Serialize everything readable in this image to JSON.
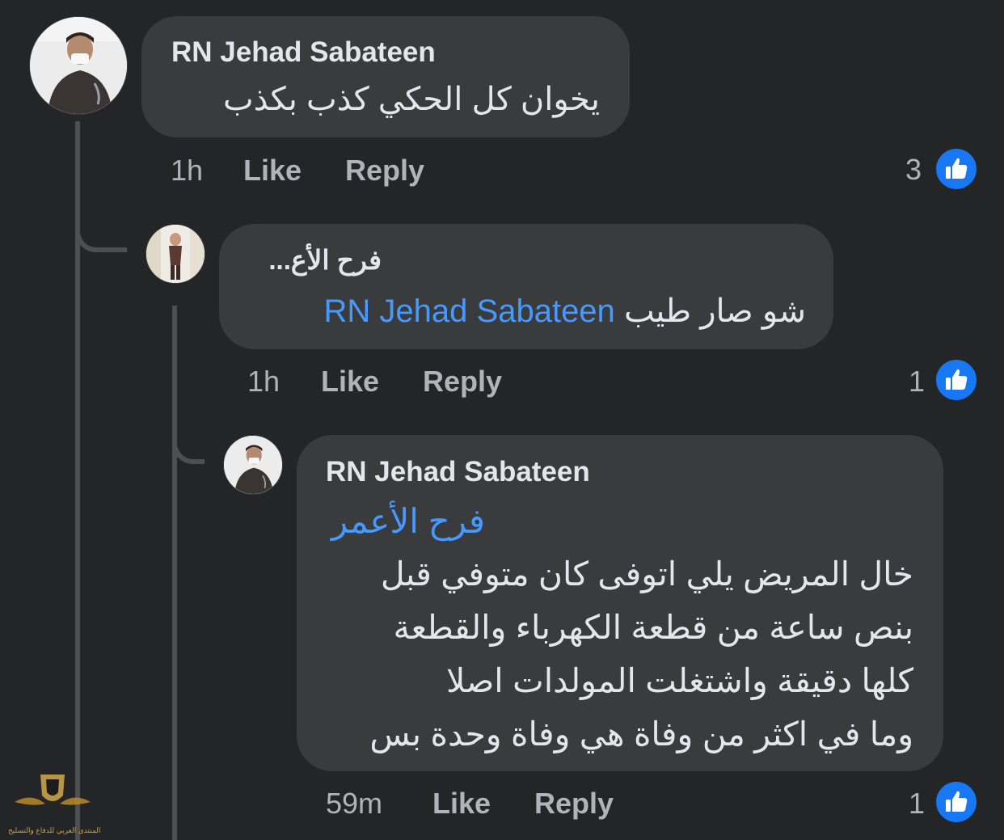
{
  "comments": [
    {
      "author": "RN Jehad Sabateen",
      "text": "يخوان كل الحكي كذب بكذب",
      "time": "1h",
      "like_label": "Like",
      "reply_label": "Reply",
      "reaction_count": "3"
    },
    {
      "author": "فرح الأع...",
      "mention": "RN Jehad Sabateen",
      "text": "شو صار طيب",
      "time": "1h",
      "like_label": "Like",
      "reply_label": "Reply",
      "reaction_count": "1"
    },
    {
      "author": "RN Jehad Sabateen",
      "mention": "فرح الأعمر",
      "lines": [
        "خال المريض يلي اتوفى كان متوفي قبل",
        "بنص ساعة من قطعة الكهرباء والقطعة",
        "كلها دقيقة واشتغلت المولدات اصلا",
        "وما في اكثر من وفاة هي وفاة وحدة بس"
      ],
      "time": "59m",
      "like_label": "Like",
      "reply_label": "Reply",
      "reaction_count": "1"
    }
  ],
  "icons": {
    "reaction": "thumbs-up-icon",
    "avatar_1": "doctor-avatar",
    "avatar_2": "user-avatar",
    "avatar_3": "doctor-avatar"
  },
  "watermark": {
    "text": "المنتدى العربي للدفاع والتسليح"
  },
  "colors": {
    "background": "#242526",
    "bubble": "#3a3b3c",
    "link": "#4599ff",
    "like": "#1877f2"
  }
}
